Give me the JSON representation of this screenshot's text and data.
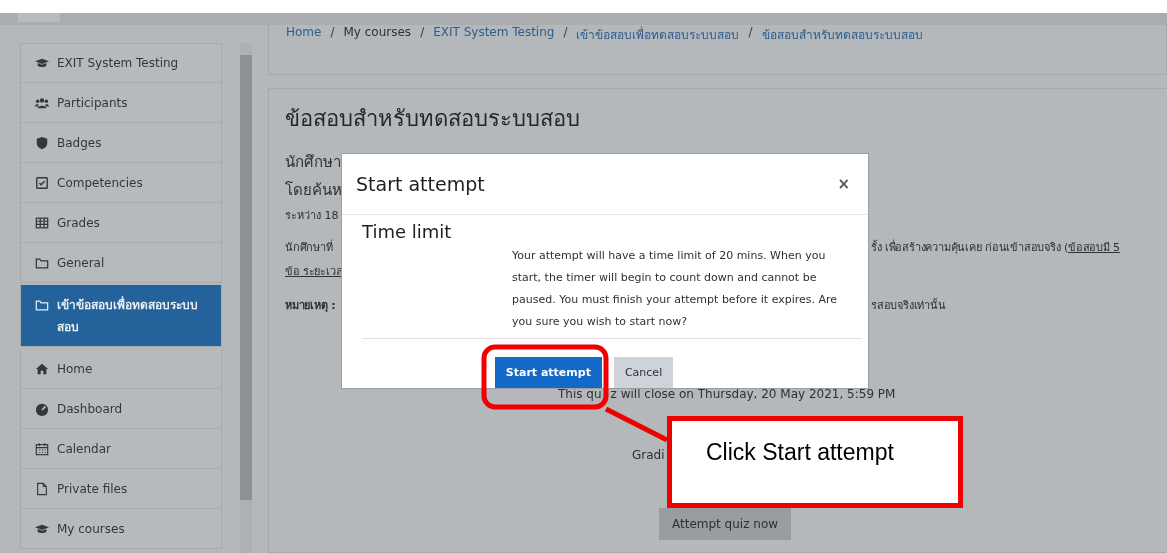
{
  "sidebar": {
    "items": [
      {
        "label": "EXIT System Testing",
        "selected": false
      },
      {
        "label": "Participants",
        "selected": false
      },
      {
        "label": "Badges",
        "selected": false
      },
      {
        "label": "Competencies",
        "selected": false
      },
      {
        "label": "Grades",
        "selected": false
      },
      {
        "label": "General",
        "selected": false
      },
      {
        "label": "เข้าข้อสอบเพื่อทดสอบระบบสอบ",
        "selected": true
      },
      {
        "label": "Home",
        "selected": false
      },
      {
        "label": "Dashboard",
        "selected": false
      },
      {
        "label": "Calendar",
        "selected": false
      },
      {
        "label": "Private files",
        "selected": false
      },
      {
        "label": "My courses",
        "selected": false
      }
    ]
  },
  "breadcrumb": [
    {
      "label": "Home",
      "kind": "crumb",
      "link": true
    },
    {
      "label": "/",
      "kind": "separator"
    },
    {
      "label": "My courses",
      "kind": "crumb",
      "link": false
    },
    {
      "label": "/",
      "kind": "separator"
    },
    {
      "label": "EXIT System Testing",
      "kind": "crumb",
      "link": true
    },
    {
      "label": "/",
      "kind": "separator"
    },
    {
      "label": "เข้าข้อสอบเพื่อทดสอบระบบสอบ",
      "kind": "crumb",
      "link": true
    },
    {
      "label": "/",
      "kind": "separator"
    },
    {
      "label": "ข้อสอบสำหรับทดสอบระบบสอบ",
      "kind": "crumb",
      "link": true
    }
  ],
  "page": {
    "title": "ข้อสอบสำหรับทดสอบระบบสอบ",
    "lines": [
      {
        "kind": "lead",
        "left": "นักศึกษา"
      },
      {
        "kind": "lead",
        "left": "โดยค้นห"
      },
      {
        "kind": "small",
        "left": "ระหว่าง 18"
      },
      {
        "kind": "para",
        "left": "นักศึกษาที่",
        "right": "รั้ง เพื่อสร้างความคุ้นเคย ก่อนเข้าสอบจริง (",
        "right_link": "ข้อสอบมี 5"
      },
      {
        "kind": "link",
        "left": "ข้อ ระยะเวล"
      },
      {
        "kind": "note",
        "left": "หมายเหตุ :",
        "right": "รสอบจริงเท่านั้น"
      }
    ],
    "close_notice": [
      "This qu",
      "z will close on Thursday, 20 May 2021, 5:59 PM"
    ],
    "grading": "Gradi",
    "attempt_button": "Attempt quiz now"
  },
  "modal": {
    "title": "Start attempt",
    "close": "×",
    "heading": "Time limit",
    "message": "Your attempt will have a time limit of 20 mins. When you start, the timer will begin to count down and cannot be paused. You must finish your attempt before it expires. Are you sure you wish to start now?",
    "buttons": [
      {
        "label": "Start attempt",
        "kind": "primary"
      },
      {
        "label": "Cancel",
        "kind": "secondary"
      }
    ]
  },
  "callout": {
    "text": "Click Start attempt"
  }
}
